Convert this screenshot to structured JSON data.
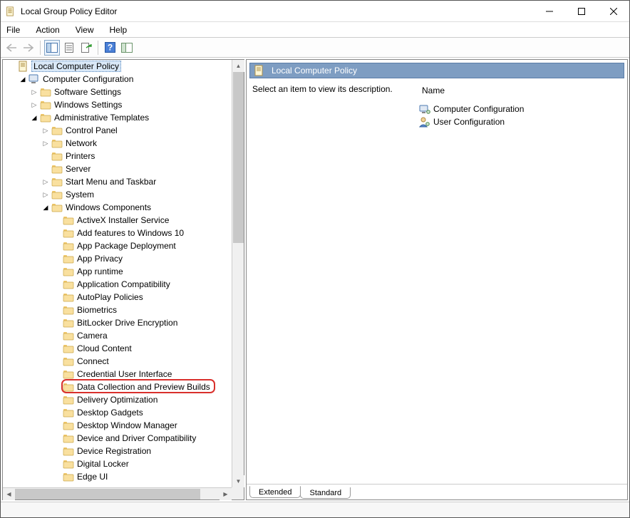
{
  "window": {
    "title": "Local Group Policy Editor"
  },
  "menu": {
    "items": [
      "File",
      "Action",
      "View",
      "Help"
    ]
  },
  "tree": {
    "root": "Local Computer Policy",
    "cc": "Computer Configuration",
    "cc_children": [
      {
        "label": "Software Settings",
        "expander": "closed",
        "indent": 2
      },
      {
        "label": "Windows Settings",
        "expander": "closed",
        "indent": 2
      },
      {
        "label": "Administrative Templates",
        "expander": "open",
        "indent": 2
      }
    ],
    "at_children": [
      {
        "label": "Control Panel",
        "expander": "closed"
      },
      {
        "label": "Network",
        "expander": "closed"
      },
      {
        "label": "Printers",
        "expander": "none"
      },
      {
        "label": "Server",
        "expander": "none"
      },
      {
        "label": "Start Menu and Taskbar",
        "expander": "closed"
      },
      {
        "label": "System",
        "expander": "closed"
      },
      {
        "label": "Windows Components",
        "expander": "open"
      }
    ],
    "wc_children": [
      "ActiveX Installer Service",
      "Add features to Windows 10",
      "App Package Deployment",
      "App Privacy",
      "App runtime",
      "Application Compatibility",
      "AutoPlay Policies",
      "Biometrics",
      "BitLocker Drive Encryption",
      "Camera",
      "Cloud Content",
      "Connect",
      "Credential User Interface",
      "Data Collection and Preview Builds",
      "Delivery Optimization",
      "Desktop Gadgets",
      "Desktop Window Manager",
      "Device and Driver Compatibility",
      "Device Registration",
      "Digital Locker",
      "Edge UI"
    ],
    "highlight_index": 13
  },
  "detail": {
    "title": "Local Computer Policy",
    "hint": "Select an item to view its description.",
    "col_header": "Name",
    "rows": [
      {
        "label": "Computer Configuration",
        "icon": "computer"
      },
      {
        "label": "User Configuration",
        "icon": "user"
      }
    ],
    "tabs": [
      "Extended",
      "Standard"
    ],
    "active_tab": 0
  }
}
